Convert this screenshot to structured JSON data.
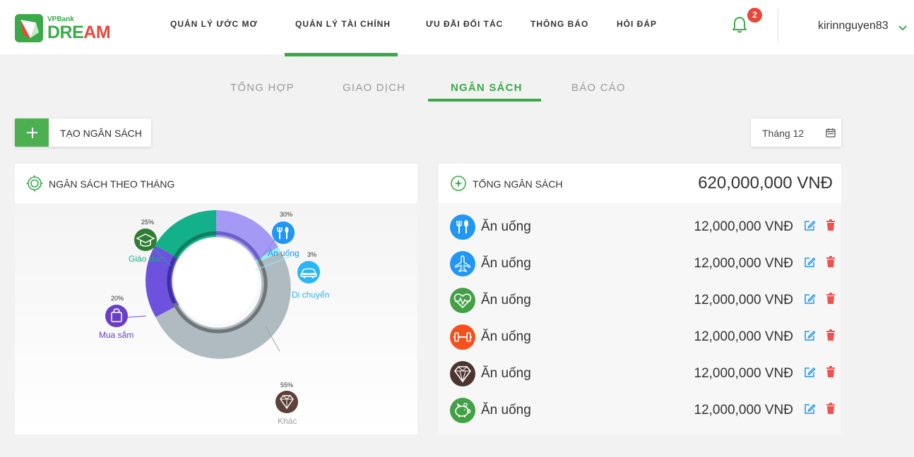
{
  "logo": {
    "small": "VPBank",
    "big_a": "DRE",
    "big_b": "AM"
  },
  "nav": [
    {
      "label": "QUẢN LÝ ƯỚC MƠ"
    },
    {
      "label": "QUẢN LÝ TÀI CHÍNH"
    },
    {
      "label": "ƯU ĐÃI ĐỐI TÁC"
    },
    {
      "label": "THÔNG BÁO"
    },
    {
      "label": "HỎI ĐÁP"
    }
  ],
  "notifications": {
    "count": "2"
  },
  "user": {
    "name": "kirinnguyen83"
  },
  "subtabs": [
    {
      "label": "TỔNG HỢP"
    },
    {
      "label": "GIAO DỊCH"
    },
    {
      "label": "NGÂN SÁCH"
    },
    {
      "label": "BÁO CÁO"
    }
  ],
  "actions": {
    "create_label": "TẠO NGÂN SÁCH",
    "month": "Tháng 12"
  },
  "monthly": {
    "title": "NGÂN SÁCH THEO THÁNG",
    "segments": [
      {
        "pct": "30%",
        "label": "Ăn uống",
        "color": "#2196f3",
        "icon": "fork-knife-icon"
      },
      {
        "pct": "3%",
        "label": "Di chuyển",
        "color": "#29b6f6",
        "icon": "car-icon"
      },
      {
        "pct": "55%",
        "label": "Khác",
        "color": "#5d4037",
        "icon": "diamond-icon"
      },
      {
        "pct": "20%",
        "label": "Mua sắm",
        "color": "#6a3fc6",
        "icon": "shopping-bag-icon"
      },
      {
        "pct": "25%",
        "label": "Giáo dục",
        "color": "#2e7d32",
        "icon": "graduation-cap-icon"
      }
    ]
  },
  "total": {
    "title": "TỔNG NGÂN SÁCH",
    "amount": "620,000,000 VNĐ",
    "rows": [
      {
        "name": "Ăn uống",
        "amount": "12,000,000 VNĐ",
        "icon": "fork-knife-icon",
        "color": "#2196f3"
      },
      {
        "name": "Ăn uống",
        "amount": "12,000,000 VNĐ",
        "icon": "airplane-icon",
        "color": "#2196f3"
      },
      {
        "name": "Ăn uống",
        "amount": "12,000,000 VNĐ",
        "icon": "heart-pulse-icon",
        "color": "#43a047"
      },
      {
        "name": "Ăn uống",
        "amount": "12,000,000 VNĐ",
        "icon": "dumbbell-icon",
        "color": "#f4511e"
      },
      {
        "name": "Ăn uống",
        "amount": "12,000,000 VNĐ",
        "icon": "diamond-icon",
        "color": "#4e342e"
      },
      {
        "name": "Ăn uống",
        "amount": "12,000,000 VNĐ",
        "icon": "piggy-bank-icon",
        "color": "#43a047"
      }
    ]
  },
  "colors": {
    "accent": "#3aaa48",
    "danger": "#e8473a",
    "edit": "#2196f3"
  }
}
